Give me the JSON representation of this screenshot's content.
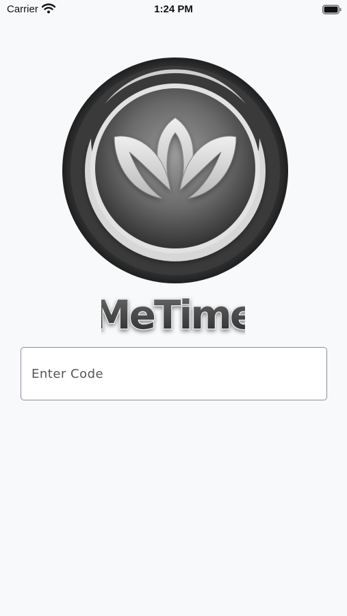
{
  "status_bar": {
    "carrier": "Carrier",
    "time": "1:24 PM",
    "icons": [
      "wifi-icon",
      "battery-icon"
    ]
  },
  "logo": {
    "icon": "lotus-logo",
    "wordmark": "MeTime"
  },
  "code_field": {
    "placeholder": "Enter Code",
    "value": ""
  },
  "colors": {
    "background": "#f7f9fb",
    "field_border": "#8e8e93",
    "logo_dark": "#2e2e2e",
    "logo_light": "#d9d9d9"
  }
}
